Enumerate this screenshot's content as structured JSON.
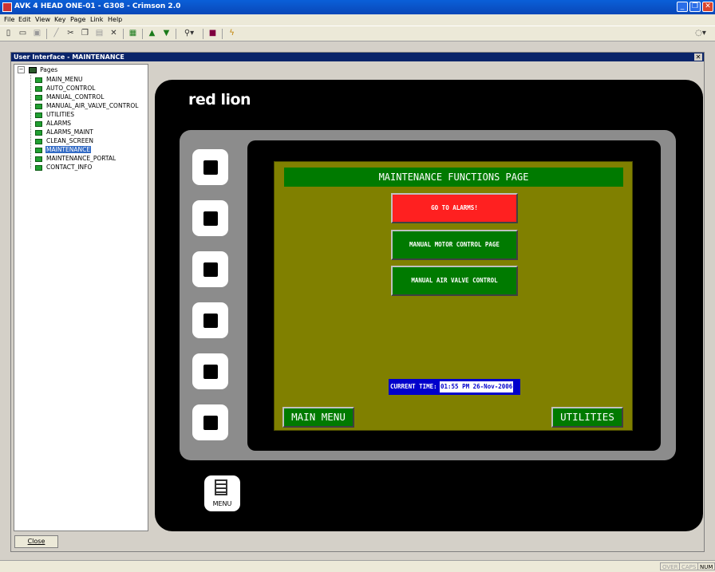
{
  "window": {
    "title": "AVK 4 HEAD ONE-01 - G308 - Crimson 2.0",
    "min_glyph": "_",
    "max_glyph": "❐",
    "close_glyph": "✕"
  },
  "menubar": {
    "items": [
      "File",
      "Edit",
      "View",
      "Key",
      "Page",
      "Link",
      "Help"
    ]
  },
  "toolbar": {
    "icons": [
      "new-file-icon",
      "open-folder-icon",
      "save-icon",
      "pencil-icon",
      "cut-icon",
      "copy-icon",
      "paste-icon",
      "delete-icon",
      "properties-icon",
      "arrow-up-icon",
      "arrow-down-icon",
      "find-icon",
      "display-icon",
      "lightning-icon",
      "help-icon"
    ]
  },
  "editor": {
    "title": "User Interface - MAINTENANCE",
    "close_glyph": "✕",
    "close_button": "Close"
  },
  "tree": {
    "root": "Pages",
    "items": [
      "MAIN_MENU",
      "AUTO_CONTROL",
      "MANUAL_CONTROL",
      "MANUAL_AIR_VALVE_CONTROL",
      "UTILITIES",
      "ALARMS",
      "ALARMS_MAINT",
      "CLEAN_SCREEN",
      "MAINTENANCE",
      "MAINTENANCE_PORTAL",
      "CONTACT_INFO"
    ],
    "selected": "MAINTENANCE"
  },
  "device": {
    "logo": "red lion",
    "menu_key": "MENU"
  },
  "hmi": {
    "header": "MAINTENANCE FUNCTIONS PAGE",
    "buttons": [
      "GO TO ALARMS!",
      "MANUAL MOTOR CONTROL PAGE",
      "MANUAL AIR VALVE CONTROL"
    ],
    "time_label": "CURRENT TIME:",
    "time_value": "01:55 PM 26-Nov-2006",
    "nav_left": "MAIN MENU",
    "nav_right": "UTILITIES",
    "colors": {
      "background": "#808000",
      "header": "#007a00",
      "alarm_button": "#ff2020",
      "time_bar": "#0000cc"
    }
  },
  "statusbar": {
    "over": "OVER",
    "caps": "CAPS",
    "num": "NUM"
  }
}
